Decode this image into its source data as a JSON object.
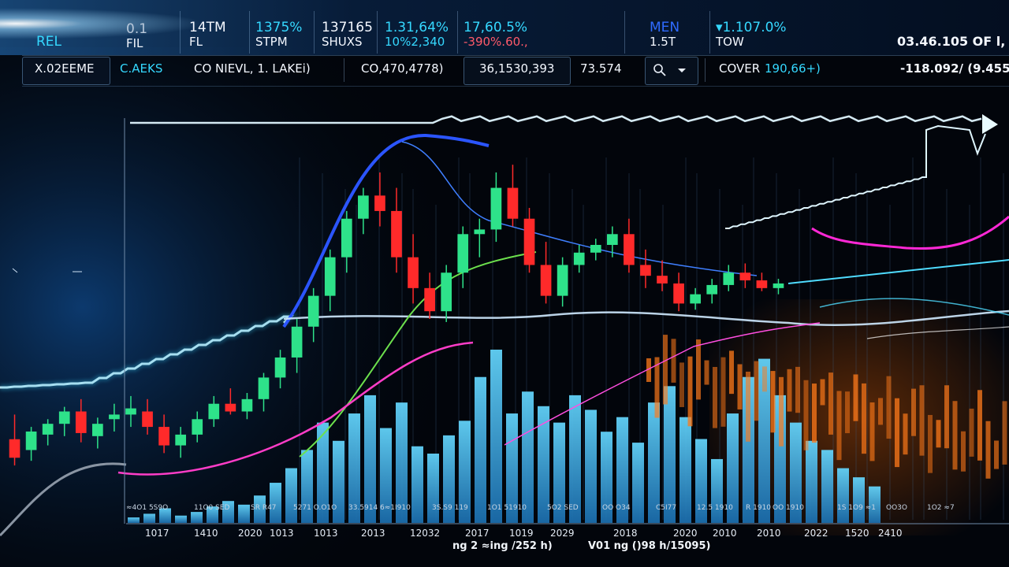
{
  "ticker": {
    "cells": [
      {
        "top": "REL",
        "bottom": ""
      },
      {
        "top": "0.1",
        "bottom": "FIL"
      },
      {
        "top": "14TM",
        "bottom": "FL"
      },
      {
        "top": "1375%",
        "bottom": "STPM"
      },
      {
        "top": "137165",
        "bottom": "SHUXS"
      },
      {
        "top": "1.31,64%",
        "bottom": "10%2,340"
      },
      {
        "top": "17,60.5%",
        "bottom": "-390%.60.,"
      },
      {
        "top": "MEN",
        "bottom": "1.5T"
      },
      {
        "top": "▾1.107.0%",
        "bottom": "TOW"
      },
      {
        "top": "",
        "bottom": "03.46.105 OF l, ⊟"
      }
    ]
  },
  "toolbar": {
    "items": [
      "X.02EEME",
      "C.AEKS",
      "CO NIEVL, 1. LAKEi)",
      "CO,470,4778)",
      "36,1530,393",
      "73.574",
      "COVER",
      "190,66+)",
      "-118.092/ (9.455"
    ]
  },
  "chart_data": {
    "type": "candlestick",
    "title": "",
    "x_tick_labels": [
      "1017",
      "1410",
      "2020",
      "1013",
      "1013",
      "2013",
      "12032",
      "2017",
      "1019",
      "2029",
      "2018",
      "2020",
      "2010",
      "2010",
      "2022",
      "1520",
      "2410"
    ],
    "inner_labels": [
      "≈4O1 5S9O",
      "11O0 SED",
      "SR R47",
      "5271 O.O1O",
      "33.5914",
      "6≈1I910",
      "3S.S9 119",
      "1O1 51910",
      "5O2 SED",
      "OO O34",
      "C5I77",
      "12.5 1910",
      "R 1910",
      "OO 1910",
      "1S 1O9 ≈1",
      "OO3O",
      "1O2 ≈7"
    ],
    "bottom_labels": [
      "ng 2 ≈ing /252 h)",
      "V01 ng ()98 h/15095)"
    ],
    "candles": [
      {
        "o": 42,
        "h": 58,
        "l": 25,
        "c": 30
      },
      {
        "o": 35,
        "h": 50,
        "l": 28,
        "c": 47
      },
      {
        "o": 45,
        "h": 55,
        "l": 38,
        "c": 52
      },
      {
        "o": 52,
        "h": 63,
        "l": 44,
        "c": 60
      },
      {
        "o": 60,
        "h": 68,
        "l": 40,
        "c": 46
      },
      {
        "o": 44,
        "h": 56,
        "l": 36,
        "c": 52
      },
      {
        "o": 55,
        "h": 65,
        "l": 47,
        "c": 58
      },
      {
        "o": 58,
        "h": 70,
        "l": 50,
        "c": 62
      },
      {
        "o": 60,
        "h": 68,
        "l": 45,
        "c": 50
      },
      {
        "o": 50,
        "h": 58,
        "l": 33,
        "c": 38
      },
      {
        "o": 38,
        "h": 50,
        "l": 30,
        "c": 45
      },
      {
        "o": 45,
        "h": 60,
        "l": 40,
        "c": 55
      },
      {
        "o": 55,
        "h": 70,
        "l": 50,
        "c": 65
      },
      {
        "o": 65,
        "h": 75,
        "l": 58,
        "c": 60
      },
      {
        "o": 60,
        "h": 72,
        "l": 55,
        "c": 68
      },
      {
        "o": 68,
        "h": 85,
        "l": 60,
        "c": 82
      },
      {
        "o": 82,
        "h": 100,
        "l": 75,
        "c": 95
      },
      {
        "o": 95,
        "h": 120,
        "l": 85,
        "c": 115
      },
      {
        "o": 115,
        "h": 140,
        "l": 105,
        "c": 135
      },
      {
        "o": 135,
        "h": 165,
        "l": 125,
        "c": 160
      },
      {
        "o": 160,
        "h": 190,
        "l": 150,
        "c": 185
      },
      {
        "o": 185,
        "h": 205,
        "l": 175,
        "c": 200
      },
      {
        "o": 200,
        "h": 215,
        "l": 180,
        "c": 190
      },
      {
        "o": 190,
        "h": 205,
        "l": 150,
        "c": 160
      },
      {
        "o": 160,
        "h": 175,
        "l": 130,
        "c": 140
      },
      {
        "o": 140,
        "h": 150,
        "l": 120,
        "c": 125
      },
      {
        "o": 125,
        "h": 155,
        "l": 118,
        "c": 150
      },
      {
        "o": 150,
        "h": 180,
        "l": 140,
        "c": 175
      },
      {
        "o": 175,
        "h": 185,
        "l": 160,
        "c": 178
      },
      {
        "o": 178,
        "h": 215,
        "l": 170,
        "c": 205
      },
      {
        "o": 205,
        "h": 220,
        "l": 180,
        "c": 185
      },
      {
        "o": 185,
        "h": 192,
        "l": 150,
        "c": 155
      },
      {
        "o": 155,
        "h": 170,
        "l": 130,
        "c": 135
      },
      {
        "o": 135,
        "h": 160,
        "l": 128,
        "c": 155
      },
      {
        "o": 155,
        "h": 168,
        "l": 150,
        "c": 163
      },
      {
        "o": 163,
        "h": 172,
        "l": 158,
        "c": 168
      },
      {
        "o": 168,
        "h": 180,
        "l": 160,
        "c": 175
      },
      {
        "o": 175,
        "h": 185,
        "l": 150,
        "c": 155
      },
      {
        "o": 155,
        "h": 165,
        "l": 140,
        "c": 148
      },
      {
        "o": 148,
        "h": 158,
        "l": 138,
        "c": 143
      },
      {
        "o": 143,
        "h": 150,
        "l": 125,
        "c": 130
      },
      {
        "o": 130,
        "h": 140,
        "l": 126,
        "c": 136
      },
      {
        "o": 136,
        "h": 146,
        "l": 130,
        "c": 142
      },
      {
        "o": 142,
        "h": 155,
        "l": 138,
        "c": 150
      },
      {
        "o": 150,
        "h": 156,
        "l": 140,
        "c": 145
      },
      {
        "o": 145,
        "h": 150,
        "l": 138,
        "c": 140
      },
      {
        "o": 140,
        "h": 146,
        "l": 136,
        "c": 143
      }
    ],
    "volume": [
      3,
      5,
      8,
      4,
      6,
      9,
      12,
      10,
      15,
      22,
      30,
      40,
      55,
      45,
      60,
      70,
      52,
      66,
      42,
      38,
      48,
      56,
      80,
      95,
      60,
      72,
      64,
      55,
      70,
      62,
      50,
      58,
      44,
      66,
      75,
      58,
      46,
      35,
      60,
      80,
      90,
      70,
      55,
      45,
      40,
      30,
      25,
      20
    ],
    "ylim": [
      0,
      240
    ],
    "grid": false,
    "legend": "none"
  },
  "colors": {
    "up": "#2ee28a",
    "down": "#ff2a2a",
    "volume": "#3fc6ff",
    "trend_white": "#dff6ff",
    "ma_blue": "#2b55ff",
    "ma_green": "#6ce04d",
    "ma_magenta": "#ff3dc8",
    "orange_bars": "#ff7a1a"
  }
}
